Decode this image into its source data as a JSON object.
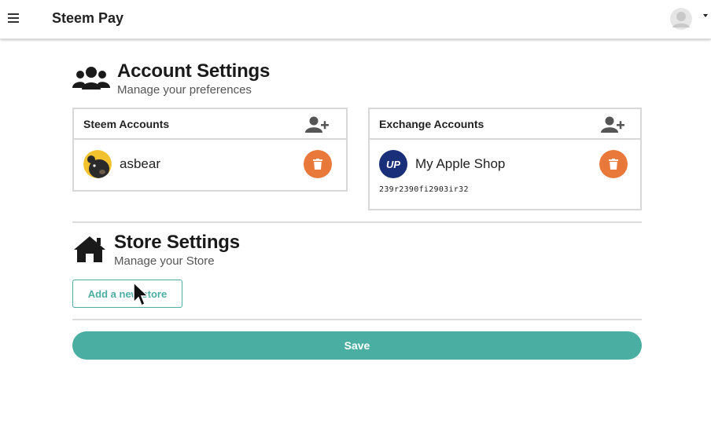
{
  "app": {
    "title": "Steem Pay"
  },
  "header": {
    "menu_icon": "hamburger-icon",
    "user_icon": "user-avatar-icon",
    "dropdown_icon": "caret-down-icon"
  },
  "account_settings": {
    "title": "Account Settings",
    "subtitle": "Manage your preferences",
    "icon": "users-group-icon",
    "steem_accounts": {
      "title": "Steem Accounts",
      "add_icon": "add-user-icon",
      "items": [
        {
          "name": "asbear",
          "avatar_icon": "bear-avatar-icon",
          "delete_icon": "trash-icon"
        }
      ]
    },
    "exchange_accounts": {
      "title": "Exchange Accounts",
      "add_icon": "add-user-icon",
      "items": [
        {
          "name": "My Apple Shop",
          "logo_text": "UP",
          "account_id": "239r2390fi2903ir32",
          "delete_icon": "trash-icon"
        }
      ]
    }
  },
  "store_settings": {
    "title": "Store Settings",
    "subtitle": "Manage your Store",
    "icon": "home-icon",
    "add_store_label": "Add a new store"
  },
  "actions": {
    "save_label": "Save"
  },
  "colors": {
    "accent": "#4aaea3",
    "delete": "#e8793a",
    "exchange_logo": "#1a2f7a"
  }
}
